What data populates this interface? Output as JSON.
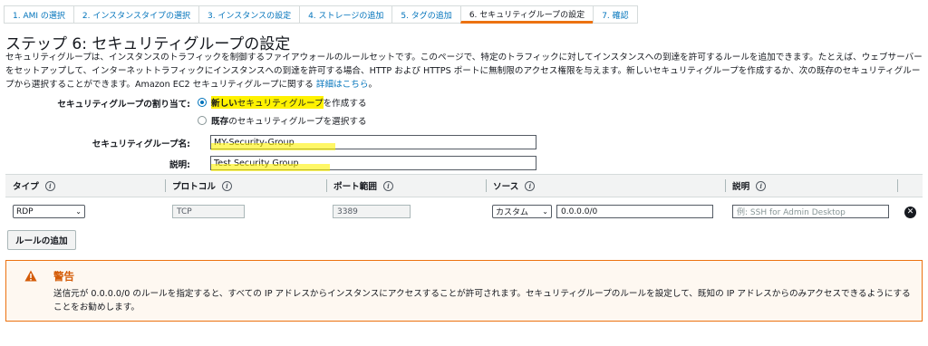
{
  "wizard": {
    "tabs": [
      {
        "label": "1. AMI の選択"
      },
      {
        "label": "2. インスタンスタイプの選択"
      },
      {
        "label": "3. インスタンスの設定"
      },
      {
        "label": "4. ストレージの追加"
      },
      {
        "label": "5. タグの追加"
      },
      {
        "label": "6. セキュリティグループの設定"
      },
      {
        "label": "7. 確認"
      }
    ],
    "active_index": 5
  },
  "page": {
    "title": "ステップ 6: セキュリティグループの設定",
    "description": "セキュリティグループは、インスタンスのトラフィックを制御するファイアウォールのルールセットです。このページで、特定のトラフィックに対してインスタンスへの到達を許可するルールを追加できます。たとえば、ウェブサーバーをセットアップして、インターネットトラフィックにインスタンスへの到達を許可する場合、HTTP および HTTPS ポートに無制限のアクセス権限を与えます。新しいセキュリティグループを作成するか、次の既存のセキュリティグループから選択することができます。Amazon EC2 セキュリティグループに関する",
    "details_link": "詳細はこちら",
    "details_suffix": "。"
  },
  "assign": {
    "label": "セキュリティグループの割り当て:",
    "option_new_bold": "新しい",
    "option_new_mid": "セキュリティグループ",
    "option_new_rest": "を作成する",
    "option_existing_bold": "既存",
    "option_existing_rest": "のセキュリティグループを選択する",
    "selected": "new"
  },
  "form": {
    "name_label": "セキュリティグループ名:",
    "name_value": "MY-Security-Group",
    "desc_label": "説明:",
    "desc_value": "Test Security Group"
  },
  "rules": {
    "headers": {
      "type": "タイプ",
      "protocol": "プロトコル",
      "port": "ポート範囲",
      "source": "ソース",
      "description": "説明"
    },
    "info_glyph": "i",
    "rows": [
      {
        "type": "RDP",
        "protocol": "TCP",
        "port": "3389",
        "source_type": "カスタム",
        "source_value": "0.0.0.0/0",
        "description_placeholder": "例: SSH for Admin Desktop"
      }
    ],
    "add_button": "ルールの追加"
  },
  "warning": {
    "title": "警告",
    "body": "送信元が 0.0.0.0/0 のルールを指定すると、すべての IP アドレスからインスタンスにアクセスすることが許可されます。セキュリティグループのルールを設定して、既知の IP アドレスからのみアクセスできるようにすることをお勧めします。"
  },
  "colors": {
    "link": "#0073bb",
    "active_tab_accent": "#ec7211",
    "warning_border": "#ec7211",
    "warning_title": "#d45b07",
    "highlight": "#fff200"
  },
  "icons": {
    "warning": "warning-triangle-icon",
    "remove": "remove-circle-icon",
    "caret": "chevron-down-icon"
  }
}
